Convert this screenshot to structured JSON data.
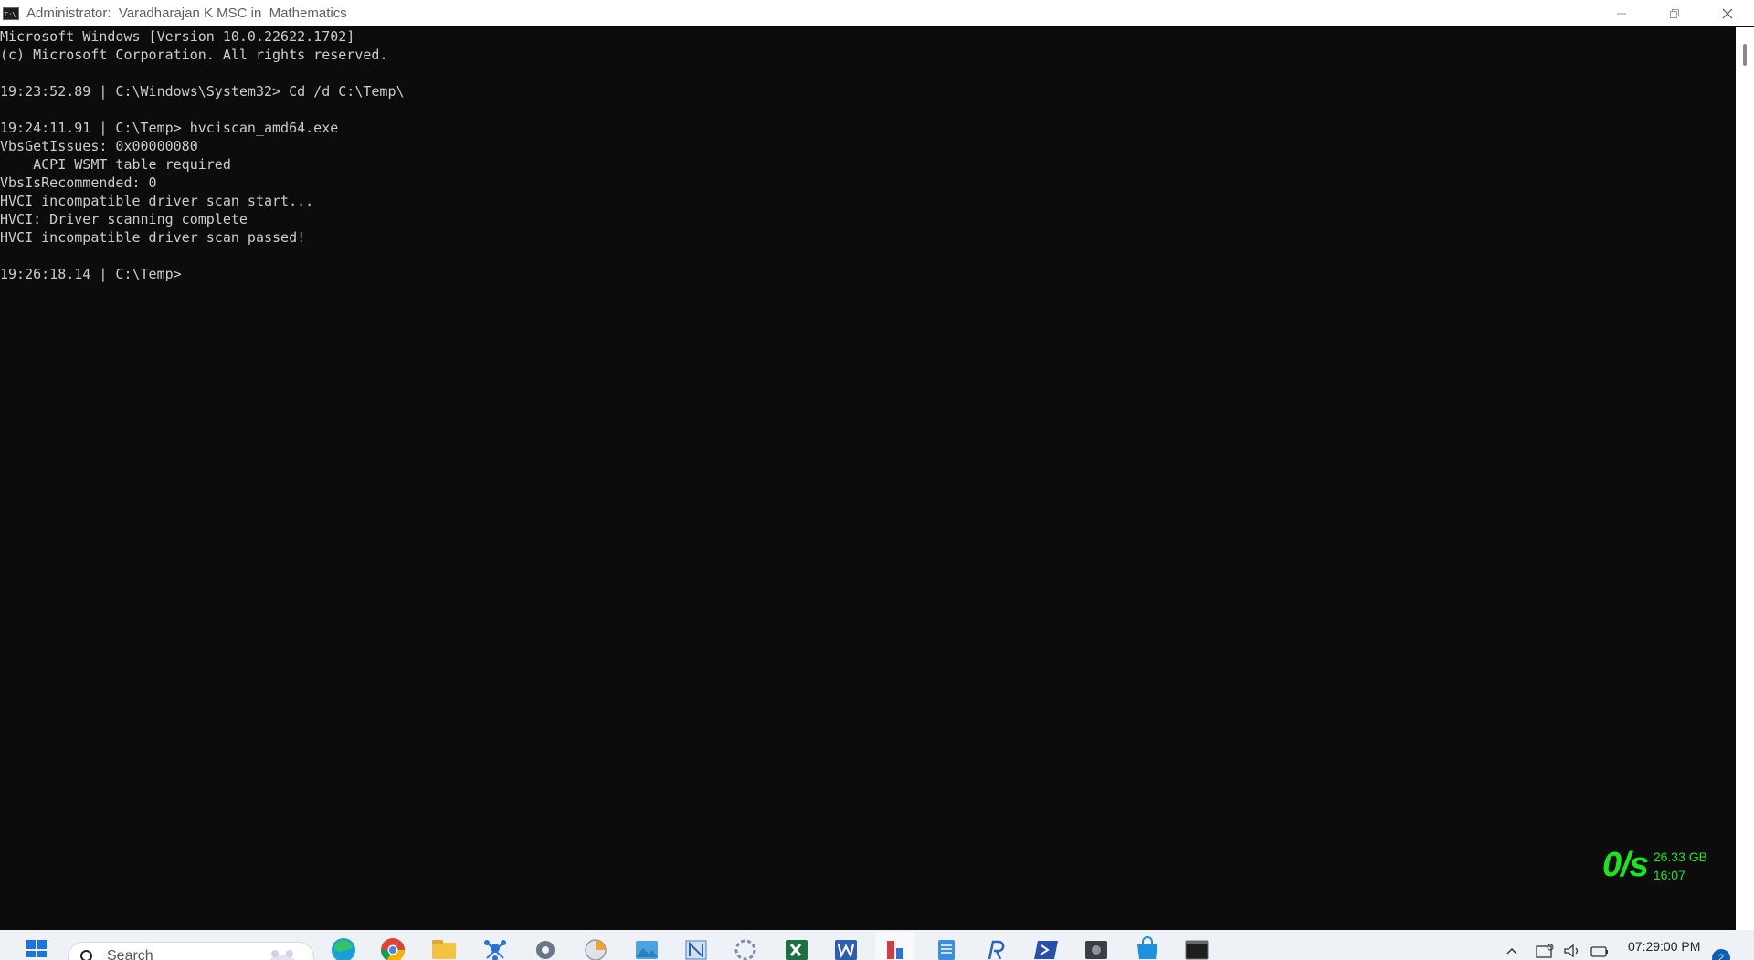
{
  "window": {
    "title": "Administrator:  Varadharajan K MSC in  Mathematics",
    "icon": "cmd-icon",
    "icon_text": "C:\\"
  },
  "console": {
    "lines": [
      "Microsoft Windows [Version 10.0.22622.1702]",
      "(c) Microsoft Corporation. All rights reserved.",
      "",
      "19:23:52.89 | C:\\Windows\\System32> Cd /d C:\\Temp\\",
      "",
      "19:24:11.91 | C:\\Temp> hvciscan_amd64.exe",
      "VbsGetIssues: 0x00000080",
      "    ACPI WSMT table required",
      "VbsIsRecommended: 0",
      "HVCI incompatible driver scan start...",
      "HVCI: Driver scanning complete",
      "HVCI incompatible driver scan passed!",
      "",
      "19:26:18.14 | C:\\Temp>"
    ]
  },
  "netspeed": {
    "rate": "0/s",
    "total": "26.33 GB",
    "time": "16:07",
    "color": "#19e619"
  },
  "taskbar": {
    "search_placeholder": "Search",
    "apps": [
      {
        "name": "start-button",
        "icon": "windows-logo-icon"
      },
      {
        "name": "edge",
        "icon": "edge-icon"
      },
      {
        "name": "chrome",
        "icon": "chrome-icon"
      },
      {
        "name": "file-explorer",
        "icon": "folder-icon"
      },
      {
        "name": "network-tool",
        "icon": "network-icon"
      },
      {
        "name": "settings",
        "icon": "gear-icon"
      },
      {
        "name": "disk-tool",
        "icon": "disk-icon"
      },
      {
        "name": "photos",
        "icon": "photos-icon"
      },
      {
        "name": "app-n",
        "icon": "n-app-icon"
      },
      {
        "name": "settings-2",
        "icon": "cog-icon"
      },
      {
        "name": "excel",
        "icon": "excel-icon"
      },
      {
        "name": "word",
        "icon": "word-icon"
      },
      {
        "name": "paint-active",
        "icon": "paint-icon"
      },
      {
        "name": "notepad",
        "icon": "notepad-icon"
      },
      {
        "name": "r-app",
        "icon": "r-icon"
      },
      {
        "name": "powershell",
        "icon": "powershell-icon"
      },
      {
        "name": "media-app",
        "icon": "media-icon"
      },
      {
        "name": "store",
        "icon": "store-icon"
      },
      {
        "name": "terminal",
        "icon": "terminal-icon"
      }
    ],
    "clock": "07:29:00 PM",
    "notification_count": "2"
  }
}
